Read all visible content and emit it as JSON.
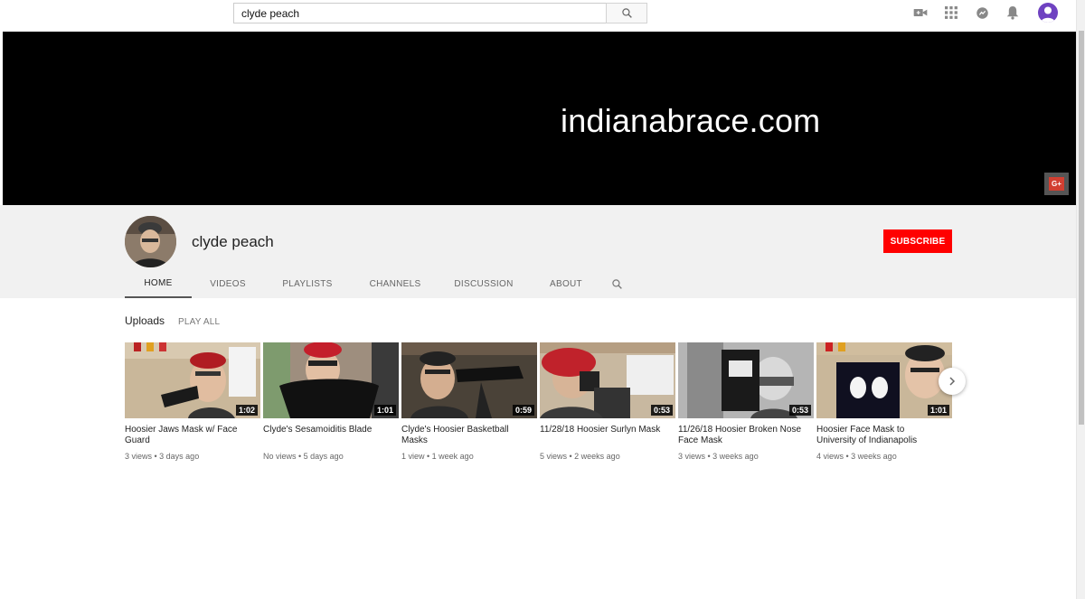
{
  "search": {
    "query": "clyde peach"
  },
  "top_icons": [
    "video-camera-icon",
    "apps-grid-icon",
    "messages-icon",
    "notifications-bell-icon",
    "account-avatar-icon"
  ],
  "banner": {
    "text": "indianabrace.com",
    "social_icon": "G+"
  },
  "channel": {
    "name": "clyde peach",
    "subscribe_label": "SUBSCRIBE",
    "tabs": [
      {
        "label": "HOME",
        "active": true
      },
      {
        "label": "VIDEOS"
      },
      {
        "label": "PLAYLISTS"
      },
      {
        "label": "CHANNELS"
      },
      {
        "label": "DISCUSSION"
      },
      {
        "label": "ABOUT"
      }
    ]
  },
  "uploads": {
    "title": "Uploads",
    "play_all": "PLAY ALL",
    "videos": [
      {
        "title": "Hoosier Jaws Mask w/ Face Guard",
        "duration": "1:02",
        "meta": "3 views • 3 days ago"
      },
      {
        "title": "Clyde's Sesamoiditis Blade",
        "duration": "1:01",
        "meta": "No views • 5 days ago"
      },
      {
        "title": "Clyde's Hoosier Basketball Masks",
        "duration": "0:59",
        "meta": "1 view • 1 week ago"
      },
      {
        "title": "11/28/18 Hoosier Surlyn Mask",
        "duration": "0:53",
        "meta": "5 views • 2 weeks ago"
      },
      {
        "title": "11/26/18 Hoosier Broken Nose Face Mask",
        "duration": "0:53",
        "meta": "3 views • 3 weeks ago"
      },
      {
        "title": "Hoosier Face Mask to University of Indianapolis",
        "duration": "1:01",
        "meta": "4 views • 3 weeks ago"
      }
    ]
  },
  "colors": {
    "subscribe": "#ff0000",
    "banner": "#000000",
    "header_bg": "#f1f1f1"
  }
}
